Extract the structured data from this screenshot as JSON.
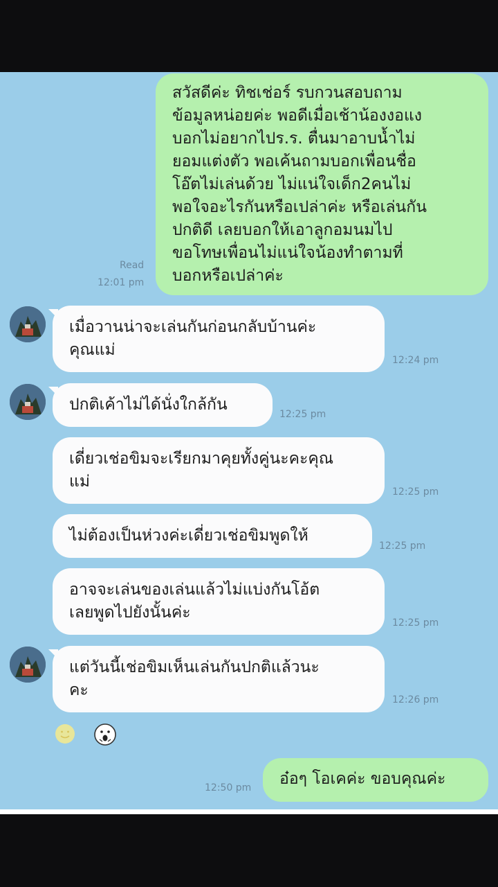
{
  "messages": [
    {
      "id": "m1",
      "side": "out",
      "text": "สวัสดีค่ะ ทิชเช่อร์ รบกวนสอบถาม\nข้อมูลหน่อยค่ะ พอดีเมื่อเช้าน้องงอแง\nบอกไม่อยากไปร.ร. ตื่นมาอาบน้ำไม่\nยอมแต่งตัว พอเค้นถามบอกเพื่อนชื่อ\nโอ๊ตไม่เล่นด้วย ไม่แน่ใจเด็ก2คนไม่\nพอใจอะไรกันหรือเปล่าค่ะ หรือเล่นกัน\nปกติดี เลยบอกให้เอาลูกอมนมไป\nขอโทษเพื่อนไม่แน่ใจน้องทำตามที่\nบอกหรือเปล่าค่ะ",
      "read": "Read",
      "time": "12:01 pm"
    },
    {
      "id": "m2",
      "side": "in",
      "text": "เมื่อวานน่าจะเล่นกันก่อนกลับบ้านค่ะ\nคุณแม่",
      "time": "12:24 pm"
    },
    {
      "id": "m3",
      "side": "in",
      "text": "ปกติเค้าไม่ได้นั่งใกล้กัน",
      "time": "12:25 pm"
    },
    {
      "id": "m4",
      "side": "in",
      "text": "เดี่ยวเช่อขิมจะเรียกมาคุยทั้งคู่นะคะคุณ\nแม่",
      "time": "12:25 pm"
    },
    {
      "id": "m5",
      "side": "in",
      "text": "ไม่ต้องเป็นห่วงค่ะเดี่ยวเช่อขิมพูดให้",
      "time": "12:25 pm"
    },
    {
      "id": "m6",
      "side": "in",
      "text": "อาจจะเล่นของเล่นแล้วไม่แบ่งกันโอ้ต\nเลยพูดไปยังนั้นค่ะ",
      "time": "12:25 pm"
    },
    {
      "id": "m7",
      "side": "in",
      "text": "แต่วันนี้เช่อขิมเห็นเล่นกันปกติแล้วนะ\nคะ",
      "time": "12:26 pm"
    },
    {
      "id": "m8",
      "side": "out",
      "text": "อ๋อๆ โอเคค่ะ ขอบคุณค่ะ",
      "time": "12:50 pm"
    }
  ],
  "reactions": [
    "smile-emoji-icon",
    "shocked-face-sticker-icon"
  ],
  "colors": {
    "chat_bg": "#9bcde9",
    "out_bubble": "#b5f0ae",
    "in_bubble": "#fbfbfc",
    "time_text": "#6b8aa0"
  }
}
